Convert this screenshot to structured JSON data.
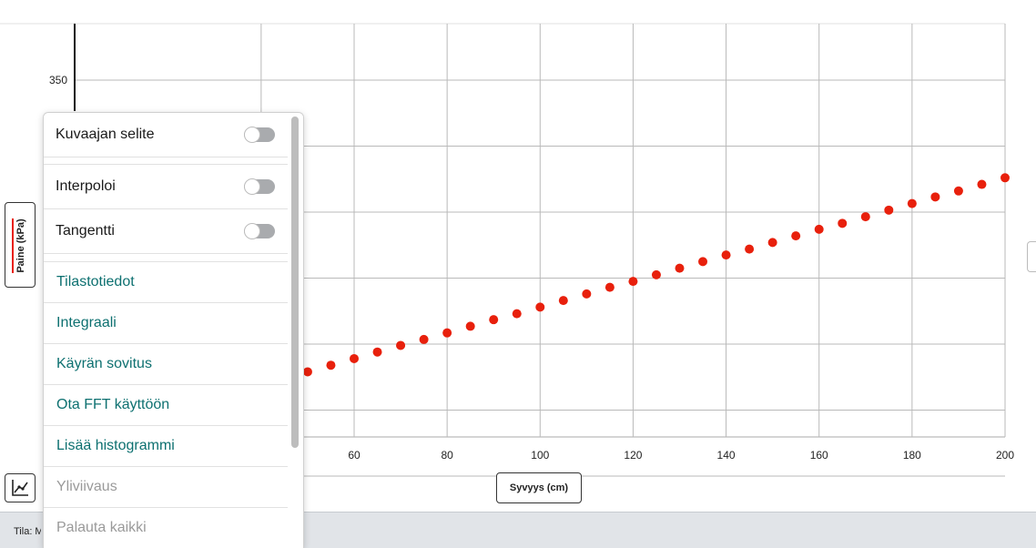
{
  "chart_data": {
    "type": "scatter",
    "xlabel": "Syvyys (cm)",
    "ylabel": "Paine (kPa)",
    "xlim": [
      40,
      200
    ],
    "ylim": [
      290,
      375
    ],
    "x_ticks": [
      60,
      80,
      100,
      120,
      140,
      160,
      180,
      200
    ],
    "y_ticks": [
      350
    ],
    "grid": true,
    "legend": "hidden",
    "series": [
      {
        "color": "#e8200c",
        "x": [
          50,
          55,
          60,
          65,
          70,
          75,
          80,
          85,
          90,
          95,
          100,
          105,
          110,
          115,
          120,
          125,
          130,
          135,
          140,
          145,
          150,
          155,
          160,
          165,
          170,
          175,
          180,
          185,
          190,
          195,
          200
        ],
        "y": [
          305.8,
          306.8,
          307.8,
          308.8,
          309.8,
          310.7,
          311.7,
          312.7,
          313.7,
          314.6,
          315.6,
          316.6,
          317.6,
          318.6,
          319.5,
          320.5,
          321.5,
          322.5,
          323.5,
          324.4,
          325.4,
          326.4,
          327.4,
          328.3,
          329.3,
          330.3,
          331.3,
          332.3,
          333.2,
          334.2,
          335.2
        ]
      }
    ]
  },
  "axes": {
    "y_button_label": "Paine (kPa)",
    "x_button_label": "Syvyys (cm)"
  },
  "menu": {
    "legend_label": "Kuvaajan selite",
    "legend_on": false,
    "interpolate_label": "Interpoloi",
    "interpolate_on": false,
    "tangent_label": "Tangentti",
    "tangent_on": false,
    "statistics_label": "Tilastotiedot",
    "integral_label": "Integraali",
    "curve_fit_label": "Käyrän sovitus",
    "fft_label": "Ota FFT käyttöön",
    "histogram_label": "Lisää histogrammi",
    "overlay_label": "Yliviivaus",
    "reset_label": "Palauta kaikki"
  },
  "status": {
    "text": "Tila: M"
  },
  "icons": {
    "chart_tools": "chart-line-icon",
    "point_color": "#e8200c",
    "link_color": "#0d7070"
  }
}
